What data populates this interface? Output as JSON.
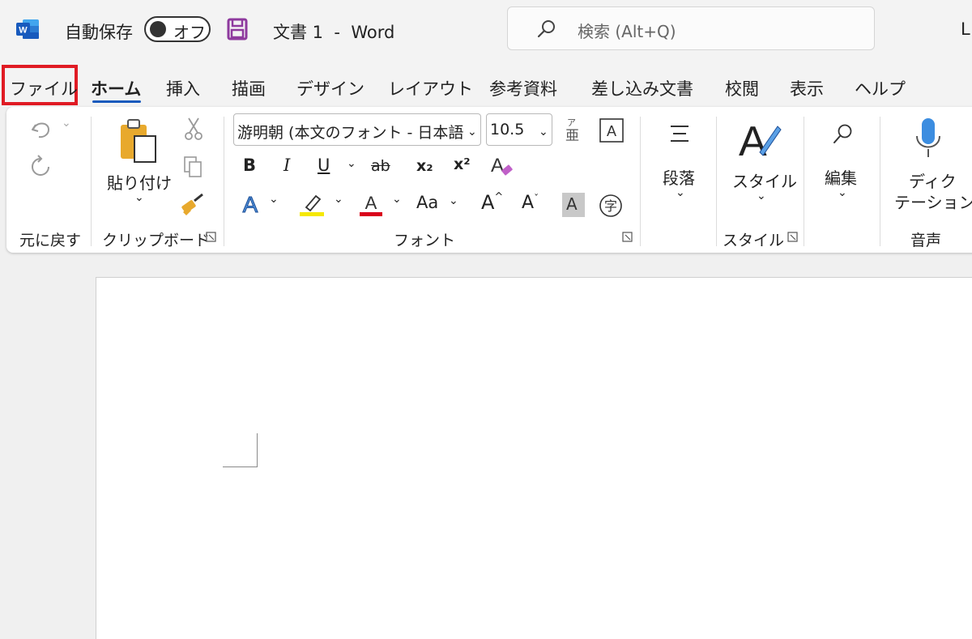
{
  "titlebar": {
    "app_icon": "word-logo-icon",
    "autosave_label": "自動保存",
    "autosave_toggle": "オフ",
    "save_icon": "save-icon",
    "doc_title": "文書 1  -  Word",
    "search_placeholder": "検索 (Alt+Q)",
    "user_initial": "L"
  },
  "tabs": [
    {
      "label": "ファイル"
    },
    {
      "label": "ホーム",
      "selected": true
    },
    {
      "label": "挿入"
    },
    {
      "label": "描画"
    },
    {
      "label": "デザイン"
    },
    {
      "label": "レイアウト"
    },
    {
      "label": "参考資料"
    },
    {
      "label": "差し込み文書"
    },
    {
      "label": "校閲"
    },
    {
      "label": "表示"
    },
    {
      "label": "ヘルプ"
    }
  ],
  "ribbon": {
    "undo": {
      "label": "元に戻す"
    },
    "clipboard": {
      "label": "クリップボード",
      "paste_label": "貼り付け"
    },
    "font": {
      "label": "フォント",
      "font_name": "游明朝 (本文のフォント - 日本語",
      "font_size": "10.5",
      "buttons": [
        "B",
        "I",
        "U",
        "ab",
        "x₂",
        "x²",
        "Aa"
      ]
    },
    "paragraph": {
      "label": "段落"
    },
    "styles": {
      "label": "スタイル",
      "group_label": "スタイル"
    },
    "editing": {
      "label": "編集"
    },
    "voice": {
      "label": "音声",
      "dictate_line1": "ディク",
      "dictate_line2": "テーション"
    }
  },
  "colors": {
    "accent": "#185abd",
    "file_highlight": "#e01b24",
    "highlight_yellow": "#f5e800",
    "font_red": "#d9001b"
  }
}
